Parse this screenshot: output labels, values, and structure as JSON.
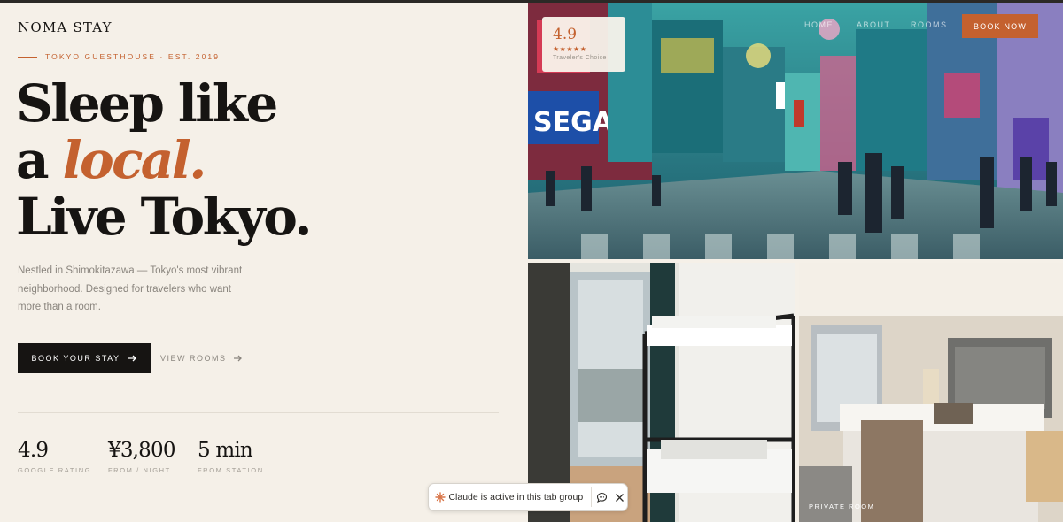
{
  "brand": {
    "logo": "NOMA STAY"
  },
  "hero": {
    "eyebrow": "TOKYO GUESTHOUSE · EST. 2019",
    "headline_line1": "Sleep like",
    "headline_line2_prefix": "a ",
    "headline_line2_accent": "local.",
    "headline_line3": "Live Tokyo.",
    "description": "Nestled in Shimokitazawa — Tokyo's most vibrant neighborhood. Designed for travelers who want more than a room.",
    "primary_cta": "BOOK YOUR STAY",
    "secondary_cta": "VIEW ROOMS"
  },
  "stats": [
    {
      "value": "4.9",
      "label": "GOOGLE RATING"
    },
    {
      "value": "¥3,800",
      "label": "FROM / NIGHT"
    },
    {
      "value": "5 min",
      "label": "FROM STATION"
    }
  ],
  "nav": {
    "home": "HOME",
    "about": "ABOUT",
    "rooms": "ROOMS",
    "book_now": "BOOK NOW"
  },
  "rating_card": {
    "score": "4.9",
    "stars": "★★★★★",
    "caption": "Traveler's Choice",
    "stars_count": 5
  },
  "gallery": {
    "private_room_label": "PRIVATE ROOM"
  },
  "toast": {
    "message": "Claude is active in this tab group"
  },
  "colors": {
    "accent": "#c4612f",
    "ink": "#161412",
    "background": "#f5f0e8",
    "muted": "#8a857e"
  },
  "icons": [
    "arrow-right-icon",
    "claude-spark-icon",
    "chat-icon",
    "close-icon"
  ]
}
